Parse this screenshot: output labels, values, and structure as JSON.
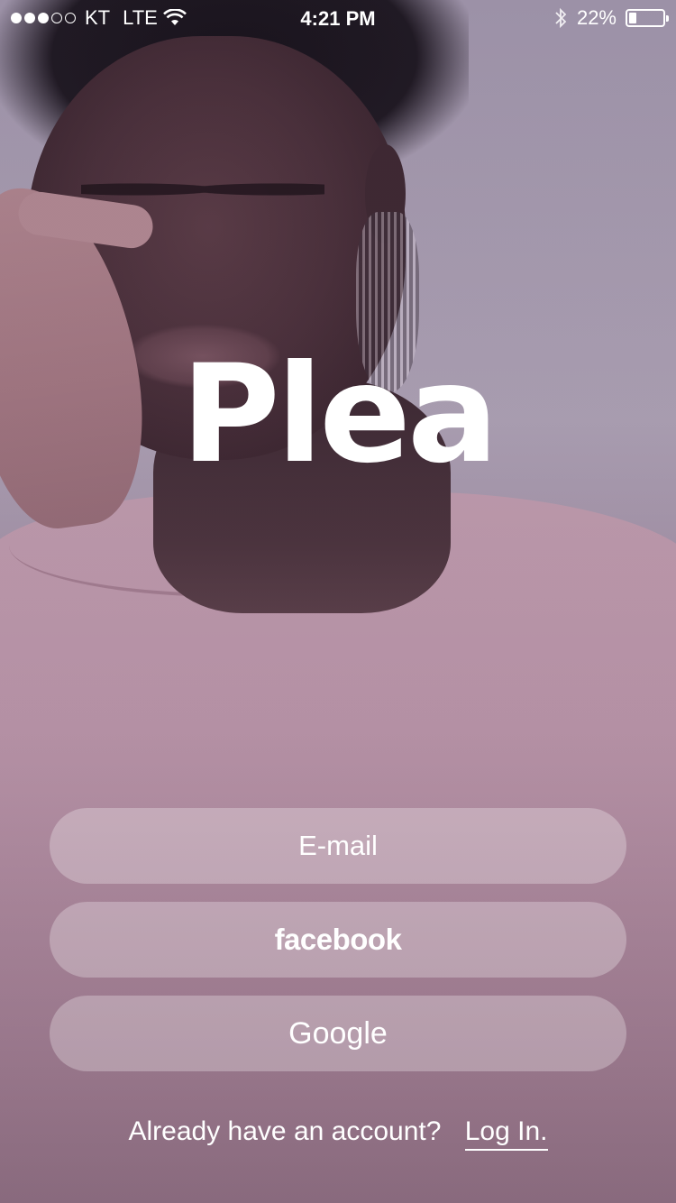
{
  "status_bar": {
    "signal_bars": 5,
    "signal_strength": 3,
    "carrier": "KT",
    "network": "LTE",
    "time": "4:21 PM",
    "battery_percent": "22%",
    "battery_level": 0.22
  },
  "logo": {
    "text": "Plea"
  },
  "auth": {
    "email_label": "E-mail",
    "facebook_label": "facebook",
    "google_label": "Google"
  },
  "footer": {
    "prompt": "Already have an account?",
    "login_label": "Log In."
  },
  "colors": {
    "text": "#ffffff",
    "button_background": "rgba(255,255,255,0.28)"
  }
}
